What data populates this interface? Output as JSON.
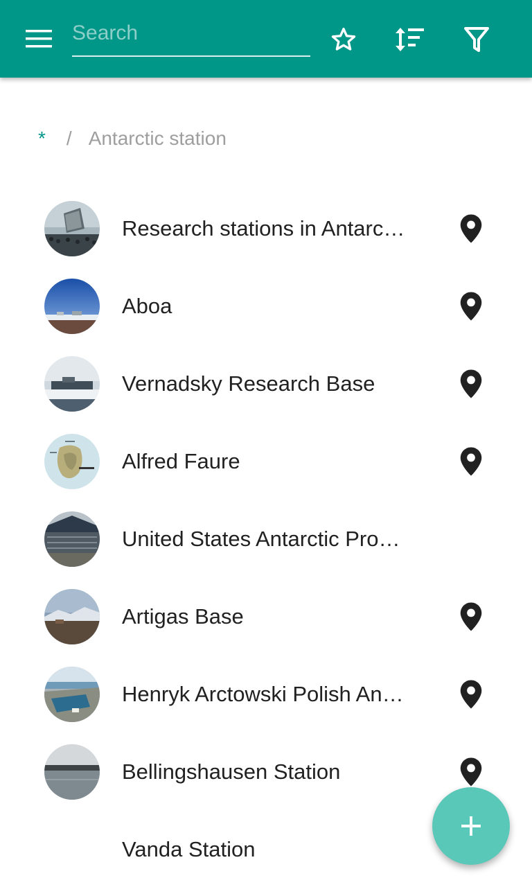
{
  "toolbar": {
    "menu_icon": "menu-icon",
    "search_placeholder": "Search",
    "search_value": "",
    "favorites_icon": "star-outline-icon",
    "sort_icon": "sort-icon",
    "filter_icon": "filter-icon",
    "color": "#009688"
  },
  "breadcrumb": {
    "root": "*",
    "separator": "/",
    "current": "Antarctic station"
  },
  "items": [
    {
      "title": "Research stations in Antarc…",
      "has_thumbnail": true,
      "has_location": true
    },
    {
      "title": "Aboa",
      "has_thumbnail": true,
      "has_location": true
    },
    {
      "title": "Vernadsky Research Base",
      "has_thumbnail": true,
      "has_location": true
    },
    {
      "title": "Alfred Faure",
      "has_thumbnail": true,
      "has_location": true
    },
    {
      "title": "United States Antarctic Pro…",
      "has_thumbnail": true,
      "has_location": false
    },
    {
      "title": "Artigas Base",
      "has_thumbnail": true,
      "has_location": true
    },
    {
      "title": "Henryk Arctowski Polish An…",
      "has_thumbnail": true,
      "has_location": true
    },
    {
      "title": "Bellingshausen Station",
      "has_thumbnail": true,
      "has_location": true
    },
    {
      "title": "Vanda Station",
      "has_thumbnail": false,
      "has_location": false
    }
  ],
  "fab": {
    "icon": "add-icon",
    "color": "#5ac8b8"
  }
}
